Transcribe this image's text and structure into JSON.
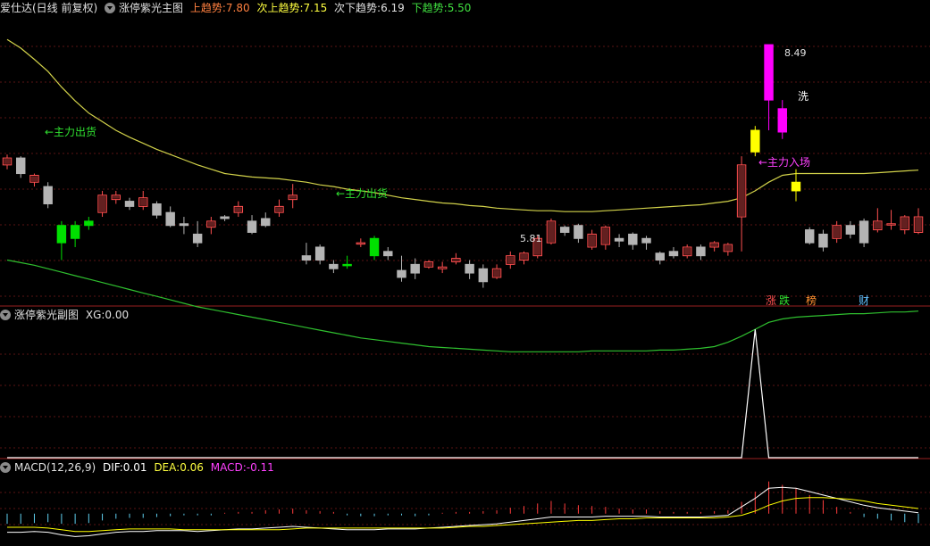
{
  "main_header": {
    "app_title": "爱仕达(日线 前复权)",
    "indicator_name": "涨停紫光主图",
    "up_label": "上趋势:",
    "up_value": "7.80",
    "sub_up_label": "次上趋势:",
    "sub_up_value": "7.15",
    "sub_down_label": "次下趋势:",
    "sub_down_value": "6.19",
    "down_label": "下趋势:",
    "down_value": "5.50"
  },
  "sub_header": {
    "indicator_name": "涨停紫光副图",
    "xg_label": "XG:",
    "xg_value": "0.00"
  },
  "macd_header": {
    "name": "MACD(12,26,9)",
    "dif_label": "DIF:",
    "dif_value": "0.01",
    "dea_label": "DEA:",
    "dea_value": "0.06",
    "macd_label": "MACD:",
    "macd_value": "-0.11"
  },
  "annotations": {
    "sell1": "←主力出货",
    "sell2": "←主力出货",
    "buy": "←主力入场",
    "high": "8.49",
    "low": "5.81",
    "wash": "洗",
    "tag_zhang": "涨",
    "tag_die": "跌",
    "tag_bang": "榜",
    "tag_cai": "财"
  },
  "colors": {
    "background": "#000000",
    "up_candle": "#ff5050",
    "down_candle": "#b4b4b4",
    "green_signal": "#00e000",
    "magenta_signal": "#ff00ff",
    "yellow_signal": "#ffff00",
    "upper_band": "#d2d24a",
    "lower_band": "#2fc02f",
    "divider": "#9a2020",
    "dif": "#ffffff",
    "dea": "#ffff00",
    "macd_pos": "#ff3c3c",
    "macd_neg": "#60d0f0"
  },
  "chart_data": {
    "type": "candlestick",
    "x": [
      1,
      2,
      3,
      4,
      5,
      6,
      7,
      8,
      9,
      10,
      11,
      12,
      13,
      14,
      15,
      16,
      17,
      18,
      19,
      20,
      21,
      22,
      23,
      24,
      25,
      26,
      27,
      28,
      29,
      30,
      31,
      32,
      33,
      34,
      35,
      36,
      37,
      38,
      39,
      40,
      41,
      42,
      43,
      44,
      45,
      46,
      47,
      48,
      49,
      50,
      51,
      52,
      53,
      54,
      55,
      56,
      57,
      58,
      59,
      60,
      61,
      62,
      63,
      64,
      65,
      66,
      67,
      68
    ],
    "open": [
      7.1,
      7.18,
      6.9,
      6.85,
      6.4,
      6.4,
      6.45,
      6.55,
      6.7,
      6.68,
      6.62,
      6.65,
      6.55,
      6.42,
      6.3,
      6.38,
      6.5,
      6.55,
      6.45,
      6.48,
      6.55,
      6.7,
      6.05,
      6.15,
      5.95,
      5.95,
      6.2,
      6.25,
      6.1,
      5.88,
      5.95,
      5.92,
      5.9,
      5.98,
      5.95,
      5.9,
      5.8,
      5.95,
      6.0,
      6.05,
      6.2,
      6.38,
      6.4,
      6.15,
      6.18,
      6.25,
      6.3,
      6.25,
      6.08,
      6.1,
      6.05,
      6.15,
      6.15,
      6.1,
      6.5,
      7.25,
      7.85,
      7.75,
      6.9,
      6.35,
      6.3,
      6.25,
      6.4,
      6.45,
      6.35,
      6.42,
      6.35,
      6.32
    ],
    "close": [
      7.18,
      7.0,
      6.98,
      6.65,
      6.2,
      6.25,
      6.4,
      6.75,
      6.75,
      6.62,
      6.72,
      6.52,
      6.4,
      6.4,
      6.2,
      6.45,
      6.48,
      6.62,
      6.32,
      6.4,
      6.62,
      6.75,
      6.0,
      6.0,
      5.9,
      5.95,
      6.2,
      6.05,
      6.05,
      5.8,
      5.85,
      5.98,
      5.92,
      6.02,
      5.85,
      5.75,
      5.9,
      6.05,
      6.08,
      6.25,
      6.45,
      6.32,
      6.25,
      6.3,
      6.38,
      6.22,
      6.18,
      6.2,
      6.0,
      6.05,
      6.15,
      6.05,
      6.2,
      6.18,
      7.1,
      7.5,
      8.49,
      7.48,
      6.8,
      6.2,
      6.15,
      6.4,
      6.3,
      6.2,
      6.45,
      6.42,
      6.5,
      6.5
    ],
    "high": [
      7.22,
      7.2,
      7.0,
      6.9,
      6.45,
      6.45,
      6.5,
      6.8,
      6.8,
      6.72,
      6.8,
      6.68,
      6.62,
      6.5,
      6.45,
      6.5,
      6.52,
      6.68,
      6.52,
      6.55,
      6.7,
      6.88,
      6.2,
      6.18,
      6.0,
      6.05,
      6.25,
      6.28,
      6.15,
      6.05,
      6.02,
      6.0,
      5.98,
      6.08,
      6.0,
      5.95,
      5.95,
      6.1,
      6.1,
      6.28,
      6.48,
      6.4,
      6.42,
      6.35,
      6.4,
      6.3,
      6.32,
      6.28,
      6.1,
      6.15,
      6.18,
      6.18,
      6.22,
      6.2,
      7.2,
      7.55,
      8.49,
      7.85,
      7.05,
      6.38,
      6.35,
      6.45,
      6.45,
      6.48,
      6.6,
      6.58,
      6.52,
      6.6
    ],
    "low": [
      7.05,
      6.95,
      6.85,
      6.6,
      6.0,
      6.15,
      6.35,
      6.5,
      6.65,
      6.58,
      6.58,
      6.48,
      6.38,
      6.3,
      6.15,
      6.3,
      6.45,
      6.5,
      6.3,
      6.38,
      6.5,
      6.6,
      5.95,
      5.95,
      5.85,
      5.9,
      6.15,
      6.0,
      6.0,
      5.75,
      5.78,
      5.9,
      5.85,
      5.95,
      5.78,
      5.68,
      5.78,
      5.9,
      5.95,
      6.02,
      6.18,
      6.28,
      6.2,
      6.12,
      6.12,
      6.15,
      6.12,
      6.12,
      5.95,
      6.02,
      6.02,
      6.0,
      6.1,
      6.05,
      6.1,
      7.2,
      7.5,
      7.4,
      6.68,
      6.18,
      6.1,
      6.2,
      6.25,
      6.15,
      6.32,
      6.35,
      6.3,
      6.3
    ],
    "ylim": [
      5.5,
      8.8
    ],
    "grid": true
  },
  "bands": {
    "upper": [
      8.55,
      8.45,
      8.32,
      8.18,
      8.0,
      7.84,
      7.7,
      7.6,
      7.5,
      7.42,
      7.35,
      7.28,
      7.22,
      7.16,
      7.1,
      7.05,
      7.0,
      6.98,
      6.96,
      6.95,
      6.94,
      6.92,
      6.9,
      6.87,
      6.85,
      6.82,
      6.8,
      6.78,
      6.75,
      6.72,
      6.7,
      6.68,
      6.66,
      6.65,
      6.63,
      6.62,
      6.6,
      6.59,
      6.58,
      6.57,
      6.57,
      6.56,
      6.56,
      6.56,
      6.57,
      6.58,
      6.59,
      6.6,
      6.61,
      6.62,
      6.63,
      6.64,
      6.66,
      6.68,
      6.72,
      6.8,
      6.9,
      6.98,
      7.0,
      7.0,
      7.0,
      7.0,
      7.0,
      7.0,
      7.01,
      7.02,
      7.03,
      7.04
    ],
    "lower": [
      6.0,
      5.97,
      5.94,
      5.9,
      5.86,
      5.82,
      5.78,
      5.74,
      5.7,
      5.66,
      5.62,
      5.58,
      5.54,
      5.5,
      5.46,
      5.43,
      5.4,
      5.37,
      5.34,
      5.31,
      5.28,
      5.25,
      5.22,
      5.19,
      5.16,
      5.13,
      5.1,
      5.08,
      5.06,
      5.04,
      5.02,
      5.0,
      4.99,
      4.98,
      4.97,
      4.96,
      4.95,
      4.94,
      4.94,
      4.94,
      4.94,
      4.94,
      4.94,
      4.95,
      4.95,
      4.95,
      4.95,
      4.95,
      4.96,
      4.96,
      4.97,
      4.98,
      5.0,
      5.05,
      5.12,
      5.2,
      5.28,
      5.32,
      5.34,
      5.35,
      5.36,
      5.37,
      5.38,
      5.38,
      5.39,
      5.4,
      5.4,
      5.41
    ]
  },
  "signals": {
    "green_bars": [
      4,
      5,
      6,
      25,
      27
    ],
    "magenta_bars": [
      56,
      57
    ],
    "yellow_bars": [
      55,
      58
    ]
  },
  "xg": {
    "values": [
      0,
      0,
      0,
      0,
      0,
      0,
      0,
      0,
      0,
      0,
      0,
      0,
      0,
      0,
      0,
      0,
      0,
      0,
      0,
      0,
      0,
      0,
      0,
      0,
      0,
      0,
      0,
      0,
      0,
      0,
      0,
      0,
      0,
      0,
      0,
      0,
      0,
      0,
      0,
      0,
      0,
      0,
      0,
      0,
      0,
      0,
      0,
      0,
      0,
      0,
      0,
      0,
      0,
      0,
      0,
      1,
      0,
      0,
      0,
      0,
      0,
      0,
      0,
      0,
      0,
      0,
      0,
      0
    ],
    "ylim": [
      0,
      1.05
    ]
  },
  "macd": {
    "ylim": [
      -0.35,
      0.45
    ],
    "hist": [
      -0.12,
      -0.12,
      -0.11,
      -0.1,
      -0.12,
      -0.12,
      -0.11,
      -0.08,
      -0.06,
      -0.05,
      -0.05,
      -0.04,
      -0.03,
      -0.02,
      -0.02,
      -0.02,
      0.01,
      0.02,
      0.02,
      0.04,
      0.05,
      0.06,
      0.04,
      0.03,
      0.02,
      -0.02,
      -0.03,
      -0.03,
      -0.02,
      -0.02,
      -0.03,
      -0.02,
      0.01,
      0.02,
      0.02,
      0.03,
      0.04,
      0.07,
      0.09,
      0.12,
      0.15,
      0.12,
      0.1,
      0.09,
      0.08,
      0.06,
      0.05,
      0.05,
      0.03,
      0.02,
      0.02,
      0.02,
      0.03,
      0.04,
      0.14,
      0.26,
      0.38,
      0.34,
      0.3,
      0.22,
      0.16,
      0.08,
      0.02,
      -0.04,
      -0.06,
      -0.08,
      -0.1,
      -0.11
    ],
    "dif": [
      -0.22,
      -0.22,
      -0.21,
      -0.22,
      -0.25,
      -0.27,
      -0.26,
      -0.24,
      -0.22,
      -0.21,
      -0.21,
      -0.2,
      -0.2,
      -0.2,
      -0.21,
      -0.2,
      -0.19,
      -0.18,
      -0.18,
      -0.17,
      -0.16,
      -0.15,
      -0.16,
      -0.17,
      -0.18,
      -0.19,
      -0.19,
      -0.19,
      -0.18,
      -0.18,
      -0.18,
      -0.17,
      -0.16,
      -0.15,
      -0.14,
      -0.13,
      -0.12,
      -0.1,
      -0.08,
      -0.06,
      -0.04,
      -0.04,
      -0.04,
      -0.04,
      -0.03,
      -0.03,
      -0.03,
      -0.03,
      -0.04,
      -0.04,
      -0.04,
      -0.04,
      -0.03,
      -0.02,
      0.08,
      0.18,
      0.3,
      0.31,
      0.3,
      0.26,
      0.22,
      0.18,
      0.14,
      0.1,
      0.07,
      0.05,
      0.03,
      0.01
    ],
    "dea": [
      -0.16,
      -0.16,
      -0.16,
      -0.17,
      -0.19,
      -0.21,
      -0.21,
      -0.2,
      -0.19,
      -0.18,
      -0.18,
      -0.18,
      -0.18,
      -0.19,
      -0.19,
      -0.19,
      -0.19,
      -0.19,
      -0.19,
      -0.19,
      -0.19,
      -0.18,
      -0.17,
      -0.17,
      -0.17,
      -0.17,
      -0.17,
      -0.17,
      -0.17,
      -0.17,
      -0.17,
      -0.17,
      -0.17,
      -0.16,
      -0.15,
      -0.15,
      -0.14,
      -0.13,
      -0.12,
      -0.11,
      -0.1,
      -0.09,
      -0.08,
      -0.08,
      -0.07,
      -0.06,
      -0.06,
      -0.05,
      -0.05,
      -0.05,
      -0.05,
      -0.05,
      -0.05,
      -0.04,
      -0.02,
      0.03,
      0.1,
      0.15,
      0.18,
      0.19,
      0.19,
      0.18,
      0.17,
      0.15,
      0.12,
      0.1,
      0.08,
      0.06
    ]
  }
}
